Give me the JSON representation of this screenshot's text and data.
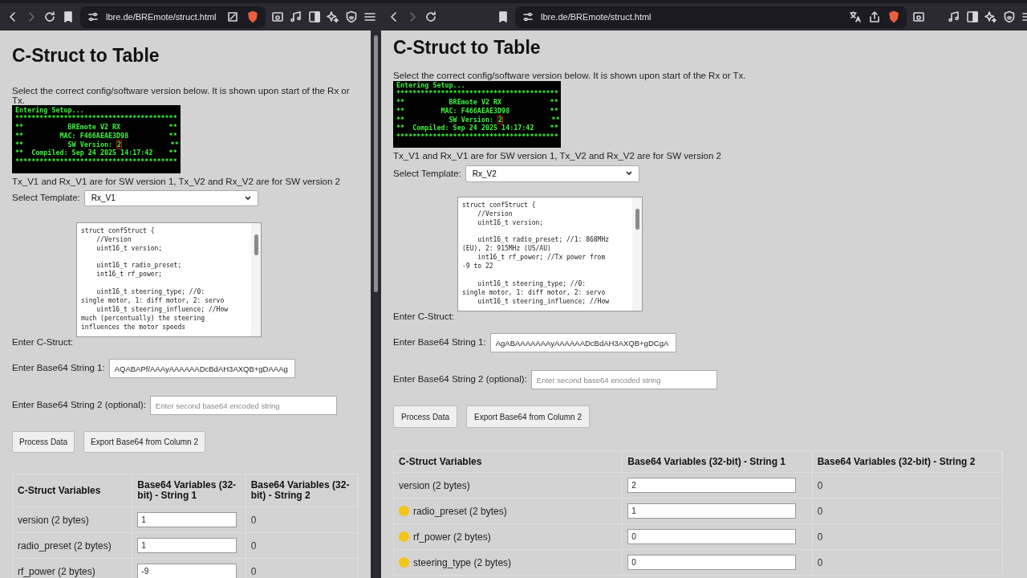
{
  "panes": [
    {
      "url": "lbre.de/BREmote/struct.html",
      "title": "C-Struct to Table",
      "intro": "Select the correct config/software version below. It is shown upon start of the Rx or Tx.",
      "terminal": [
        {
          "text": "Entering Setup..."
        },
        {
          "text": "****************************************"
        },
        {
          "text": "**           BREmote V2 RX            **"
        },
        {
          "text": "**         MAC: F466AEAE3D98          **"
        },
        {
          "text": "**           SW Version: ",
          "boxed": "2",
          "tail": "            **"
        },
        {
          "text": "**  Compiled: Sep 24 2025 14:17:42    **"
        },
        {
          "text": "****************************************"
        }
      ],
      "note": "Tx_V1 and Rx_V1 are for SW version 1, Tx_V2 and Rx_V2 are for SW version 2",
      "template_label": "Select Template:",
      "template_value": "Rx_V1",
      "code": "struct confStruct {\n    //Version\n    uint16_t version;\n\n    uint16_t radio_preset;\n    int16_t rf_power;\n\n    uint16_t steering_type; //0:\nsingle motor, 1: diff motor, 2: servo\n    uint16_t steering_influence; //How\nmuch (percentually) the steering\ninfluences the motor speeds",
      "struct_label": "Enter C-Struct:",
      "b64_1_label": "Enter Base64 String 1:",
      "b64_1_value": "AQABAPf/AAAyAAAAAADcBdAH3AXQB+gDAAAg",
      "b64_2_label": "Enter Base64 String 2 (optional):",
      "b64_2_placeholder": "Enter second base64 encoded string",
      "buttons": [
        "Process Data",
        "Export Base64 from Column 2"
      ],
      "columns": [
        "C-Struct Variables",
        "Base64 Variables (32-bit) - String 1",
        "Base64 Variables (32-bit) - String 2"
      ],
      "rows": [
        {
          "name": "version (2 bytes)",
          "warning": false,
          "value_1": "1",
          "value_2": "0"
        },
        {
          "name": "radio_preset (2 bytes)",
          "warning": false,
          "value_1": "1",
          "value_2": "0"
        },
        {
          "name": "rf_power (2 bytes)",
          "warning": false,
          "value_1": "-9",
          "value_2": "0"
        }
      ]
    },
    {
      "url": "lbre.de/BREmote/struct.html",
      "title": "C-Struct to Table",
      "intro": "Select the correct config/software version below. It is shown upon start of the Rx or Tx.",
      "terminal": [
        {
          "text": "Entering Setup..."
        },
        {
          "text": "****************************************"
        },
        {
          "text": "**           BREmote V2 RX            **"
        },
        {
          "text": "**         MAC: F466AEAE3D98          **"
        },
        {
          "text": "**           SW Version: ",
          "boxed": "2",
          "tail": "            **"
        },
        {
          "text": "**  Compiled: Sep 24 2025 14:17:42    **"
        },
        {
          "text": "****************************************"
        }
      ],
      "note": "Tx_V1 and Rx_V1 are for SW version 1, Tx_V2 and Rx_V2 are for SW version 2",
      "template_label": "Select Template:",
      "template_value": "Rx_V2",
      "code": "struct confStruct {\n    //Version\n    uint16_t version;\n\n    uint16_t radio_preset; //1: 868MHz\n(EU), 2: 915MHz (US/AU)\n    int16_t rf_power; //Tx power from\n-9 to 22\n\n    uint16_t steering_type; //0:\nsingle motor, 1: diff motor, 2: servo\n    uint16_t steering_influence; //How",
      "struct_label": "Enter C-Struct:",
      "b64_1_label": "Enter Base64 String 1:",
      "b64_1_value": "AgABAAAAAAAyAAAAAADcBdAH3AXQB+gDCgA",
      "b64_2_label": "Enter Base64 String 2 (optional):",
      "b64_2_placeholder": "Enter second base64 encoded string",
      "buttons": [
        "Process Data",
        "Export Base64 from Column 2"
      ],
      "columns": [
        "C-Struct Variables",
        "Base64 Variables (32-bit) - String 1",
        "Base64 Variables (32-bit) - String 2"
      ],
      "rows": [
        {
          "name": "version (2 bytes)",
          "warning": false,
          "value_1": "2",
          "value_2": "0"
        },
        {
          "name": "radio_preset (2 bytes)",
          "warning": true,
          "value_1": "1",
          "value_2": "0"
        },
        {
          "name": "rf_power (2 bytes)",
          "warning": true,
          "value_1": "0",
          "value_2": "0"
        },
        {
          "name": "steering_type (2 bytes)",
          "warning": true,
          "value_1": "0",
          "value_2": "0"
        }
      ]
    }
  ]
}
